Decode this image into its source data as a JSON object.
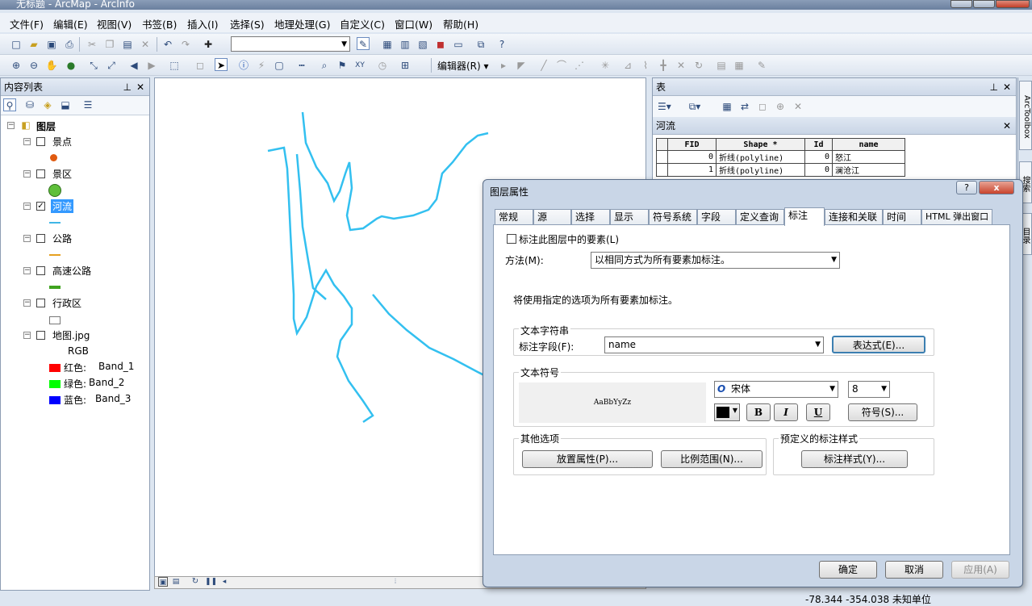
{
  "app": {
    "title": "无标题 - ArcMap - ArcInfo"
  },
  "menu": [
    "文件(F)",
    "编辑(E)",
    "视图(V)",
    "书签(B)",
    "插入(I)",
    "选择(S)",
    "地理处理(G)",
    "自定义(C)",
    "窗口(W)",
    "帮助(H)"
  ],
  "toolbar": {
    "editor_label": "编辑器(R)"
  },
  "toc": {
    "title": "内容列表",
    "root": "图层",
    "layers": [
      {
        "name": "景点",
        "checked": false,
        "symbol_color": "#e05a10"
      },
      {
        "name": "景区",
        "checked": false,
        "symbol_color": "#5fbf3a"
      },
      {
        "name": "河流",
        "checked": true,
        "symbol_color": "#3fb6e6"
      },
      {
        "name": "公路",
        "checked": false,
        "symbol_color": "#e6a020"
      },
      {
        "name": "高速公路",
        "checked": false,
        "symbol_color": "#3fa31f"
      },
      {
        "name": "行政区",
        "checked": false,
        "symbol_color": "#ffffff"
      },
      {
        "name": "地图.jpg",
        "checked": false,
        "symbol_color": ""
      }
    ],
    "raster": {
      "label": "RGB",
      "bands": [
        {
          "color_name": "红色:",
          "band": "Band_1",
          "color": "#ff0000"
        },
        {
          "color_name": "绿色:",
          "band": "Band_2",
          "color": "#00ff00"
        },
        {
          "color_name": "蓝色:",
          "band": "Band_3",
          "color": "#0000ff"
        }
      ]
    }
  },
  "table": {
    "title": "表",
    "layer": "河流",
    "columns": [
      "FID",
      "Shape *",
      "Id",
      "name"
    ],
    "rows": [
      [
        "0",
        "折线(polyline)",
        "0",
        "怒江"
      ],
      [
        "1",
        "折线(polyline)",
        "0",
        "澜沧江"
      ]
    ]
  },
  "dialog": {
    "title": "图层属性",
    "tabs": [
      "常规",
      "源",
      "选择",
      "显示",
      "符号系统",
      "字段",
      "定义查询",
      "标注",
      "连接和关联",
      "时间",
      "HTML 弹出窗口"
    ],
    "active_tab": "标注",
    "label_checkbox": "标注此图层中的要素(L)",
    "method_label": "方法(M):",
    "method_value": "以相同方式为所有要素加标注。",
    "info": "将使用指定的选项为所有要素加标注。",
    "text_string_group": "文本字符串",
    "label_field_label": "标注字段(F):",
    "label_field_value": "name",
    "expression_button": "表达式(E)...",
    "text_symbol_group": "文本符号",
    "preview_text": "AaBbYyZz",
    "font_value": "宋体",
    "size_value": "8",
    "bold": "B",
    "italic": "I",
    "underline": "U",
    "symbol_button": "符号(S)...",
    "other_group": "其他选项",
    "placement_button": "放置属性(P)...",
    "scale_button": "比例范围(N)...",
    "predefined_group": "预定义的标注样式",
    "style_button": "标注样式(Y)...",
    "ok": "确定",
    "cancel": "取消",
    "apply": "应用(A)",
    "help": "?",
    "close": "x"
  },
  "side_tabs": [
    "ArcToolbox",
    "搜索",
    "目录"
  ],
  "status": {
    "coords": "-78.344  -354.038 未知单位"
  }
}
